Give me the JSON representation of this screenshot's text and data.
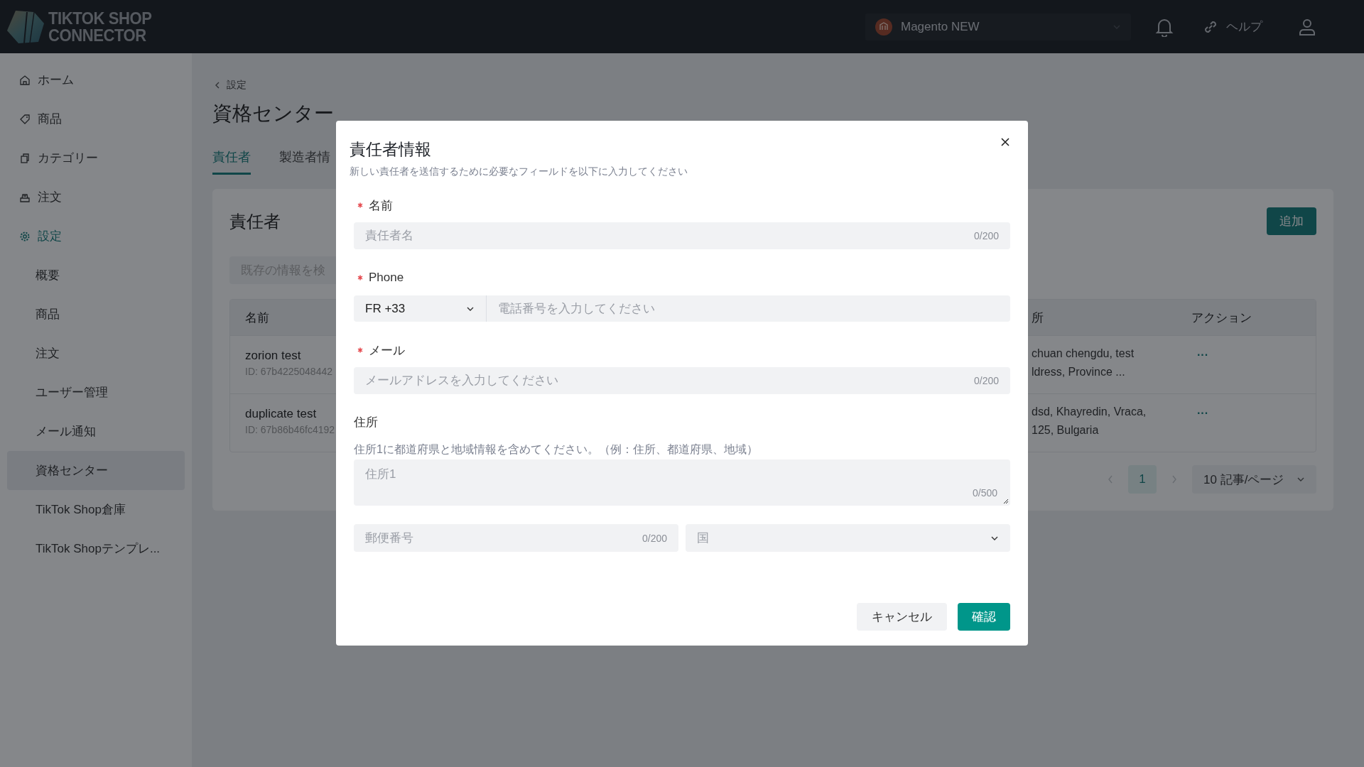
{
  "header": {
    "logo_lines": [
      "TIKTOK SHOP",
      "CONNECTOR"
    ],
    "store_selector": "Magento NEW",
    "help_link": "ヘルプ"
  },
  "sidebar": {
    "items": [
      {
        "label": "ホーム",
        "kind": "main",
        "selected": false
      },
      {
        "label": "商品",
        "kind": "main",
        "selected": false
      },
      {
        "label": "カテゴリー",
        "kind": "main",
        "selected": false
      },
      {
        "label": "注文",
        "kind": "main",
        "selected": false
      },
      {
        "label": "設定",
        "kind": "main",
        "selected": true
      },
      {
        "label": "概要",
        "kind": "sub",
        "selected": false
      },
      {
        "label": "商品",
        "kind": "sub",
        "selected": false
      },
      {
        "label": "注文",
        "kind": "sub",
        "selected": false
      },
      {
        "label": "ユーザー管理",
        "kind": "sub",
        "selected": false
      },
      {
        "label": "メール通知",
        "kind": "sub",
        "selected": false
      },
      {
        "label": "資格センター",
        "kind": "sub",
        "selected": true
      },
      {
        "label": "TikTok Shop倉庫",
        "kind": "sub",
        "selected": false
      },
      {
        "label": "TikTok Shopテンプレ...",
        "kind": "sub",
        "selected": false
      }
    ]
  },
  "page": {
    "breadcrumb": "設定",
    "title": "資格センター",
    "tabs": [
      {
        "label": "責任者",
        "selected": true
      },
      {
        "label": "製造者情",
        "selected": false
      }
    ],
    "card": {
      "title": "責任者",
      "add_button": "追加",
      "search": {
        "placeholder": "既存の情報を検"
      },
      "table": {
        "columns": [
          "名前",
          "所",
          "アクション"
        ],
        "rows": [
          {
            "name": "zorion test",
            "id": "ID: 67b4225048442",
            "address": [
              "chuan chengdu, test",
              "ldress, Province ..."
            ],
            "action": "···"
          },
          {
            "name": "duplicate test",
            "id": "ID: 67b86b46fc4192",
            "address": [
              "dsd, Khayredin, Vraca,",
              "125, Bulgaria"
            ],
            "action": "···"
          }
        ]
      },
      "pagination": {
        "pages": [
          {
            "label": "1",
            "selected": true
          }
        ],
        "page_size": "10 記事/ページ"
      }
    }
  },
  "dialog": {
    "title": "責任者情報",
    "subtitle": "新しい責任者を送信するために必要なフィールドを以下に入力してください",
    "name_field": {
      "label": "名前",
      "required": true,
      "placeholder": "責任者名",
      "counter": "0/200"
    },
    "phone_field": {
      "label": "Phone",
      "required": true,
      "country_code": "FR +33",
      "placeholder": "電話番号を入力してください"
    },
    "email_field": {
      "label": "メール",
      "required": true,
      "placeholder": "メールアドレスを入力してください",
      "counter": "0/200"
    },
    "address": {
      "label": "住所",
      "hint": "住所1に都道府県と地域情報を含めてください。（例：住所、都道府県、地域）",
      "line1": {
        "placeholder": "住所1",
        "counter": "0/500"
      },
      "postal_code": {
        "placeholder": "郵便番号",
        "counter": "0/200"
      },
      "country": {
        "placeholder": "国"
      }
    },
    "buttons": [
      {
        "label": "キャンセル",
        "kind": "secondary"
      },
      {
        "label": "確認",
        "kind": "primary"
      }
    ]
  }
}
